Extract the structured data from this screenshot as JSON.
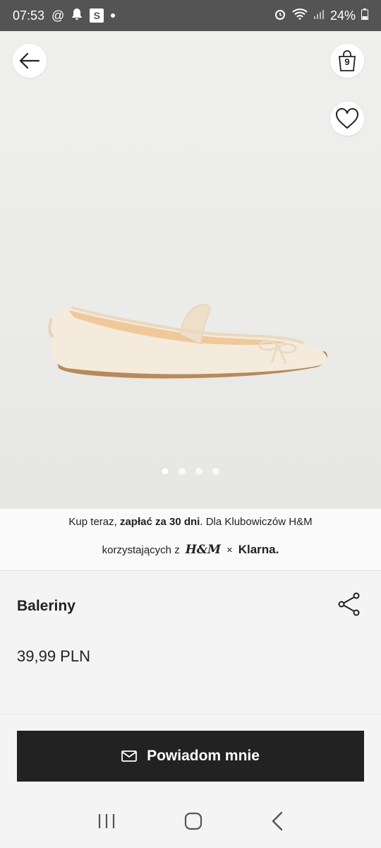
{
  "status_bar": {
    "time": "07:53",
    "battery": "24%"
  },
  "product": {
    "name": "Baleriny",
    "price": "39,99 PLN",
    "bag_count": "9",
    "image_count": 4,
    "active_image": 0
  },
  "klarna": {
    "line1_prefix": "Kup teraz, ",
    "line1_bold": "zapłać za 30 dni",
    "line1_suffix": ". Dla Klubowiczów H&M",
    "line2_text": "korzystających z",
    "hm_logo": "H&M",
    "times": "×",
    "klarna_logo": "Klarna."
  },
  "cta": {
    "label": "Powiadom mnie"
  },
  "icons": [
    "back-arrow-icon",
    "shopping-bag-icon",
    "heart-icon",
    "share-icon",
    "mail-icon",
    "recent-apps-icon",
    "home-icon",
    "back-icon"
  ],
  "colors": {
    "button_bg": "#222222",
    "status_bar_bg": "#545454"
  }
}
